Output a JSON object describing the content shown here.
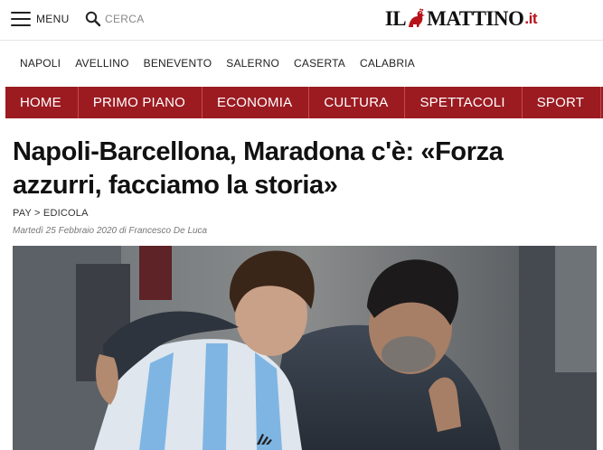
{
  "header": {
    "menu_label": "MENU",
    "search_label": "CERCA",
    "logo": {
      "left": "IL",
      "right": "MATTINO",
      "tld": ".it"
    }
  },
  "citynav": [
    "NAPOLI",
    "AVELLINO",
    "BENEVENTO",
    "SALERNO",
    "CASERTA",
    "CALABRIA"
  ],
  "sectionnav": [
    "HOME",
    "PRIMO PIANO",
    "ECONOMIA",
    "CULTURA",
    "SPETTACOLI",
    "SPORT"
  ],
  "article": {
    "headline": "Napoli-Barcellona, Maradona c'è: «Forza azzurri, facciamo la storia»",
    "breadcrumb": "PAY > EDICOLA",
    "byline": "Martedì 25 Febbraio 2020 di Francesco De Luca",
    "photo_alt": "Maradona abbraccia Messi"
  },
  "colors": {
    "accent": "#9b1b21",
    "logo_tld": "#b8121b"
  }
}
